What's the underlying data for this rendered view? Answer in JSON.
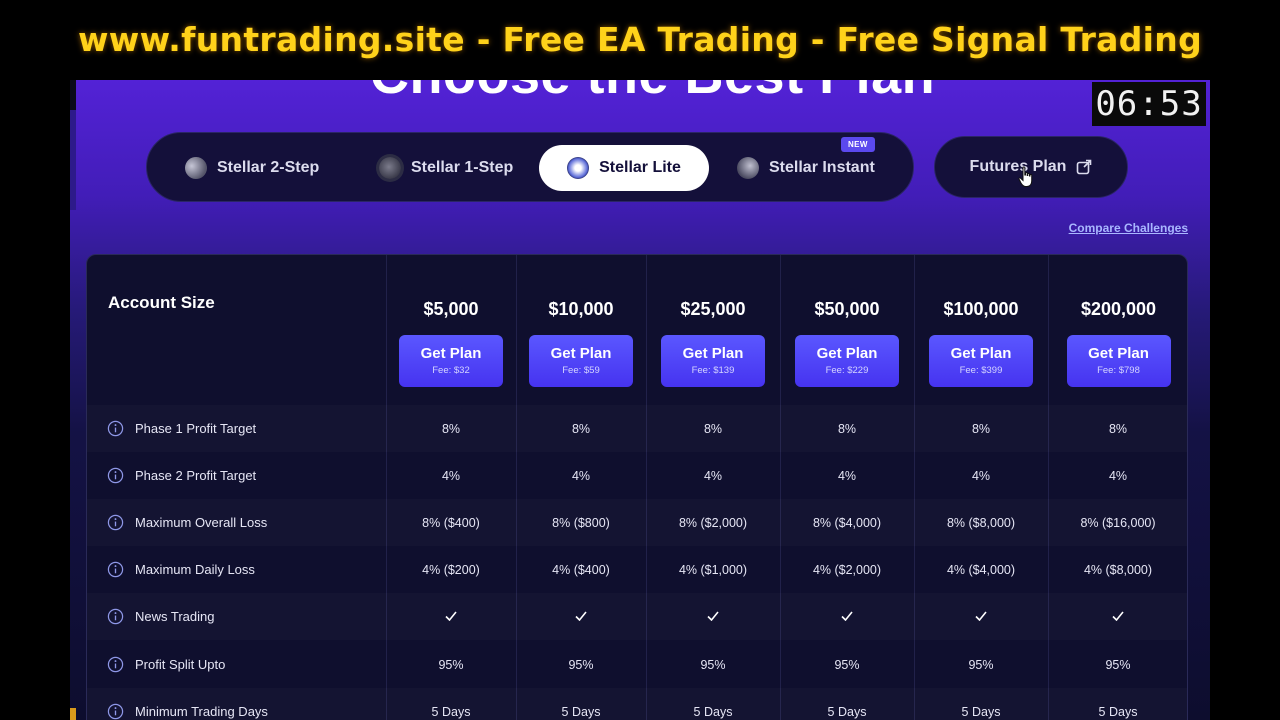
{
  "banner": {
    "text": "www.funtrading.site - Free EA Trading - Free Signal Trading"
  },
  "heading": "Choose the Best Plan",
  "timer": "06:53",
  "tabs": [
    {
      "label": "Stellar 2-Step",
      "icon": "planet-icon",
      "active": false
    },
    {
      "label": "Stellar 1-Step",
      "icon": "moon-icon",
      "active": false
    },
    {
      "label": "Stellar Lite",
      "icon": "ringed-planet-icon",
      "active": true
    },
    {
      "label": "Stellar Instant",
      "icon": "comet-icon",
      "active": false
    }
  ],
  "new_badge": "NEW",
  "futures": {
    "label": "Futures Plan",
    "icon": "external-link-icon"
  },
  "compare_link": "Compare Challenges",
  "table": {
    "size_label": "Account Size",
    "button_label": "Get Plan",
    "plans": [
      {
        "price": "$5,000",
        "fee": "Fee: $32"
      },
      {
        "price": "$10,000",
        "fee": "Fee: $59"
      },
      {
        "price": "$25,000",
        "fee": "Fee: $139"
      },
      {
        "price": "$50,000",
        "fee": "Fee: $229"
      },
      {
        "price": "$100,000",
        "fee": "Fee: $399"
      },
      {
        "price": "$200,000",
        "fee": "Fee: $798"
      }
    ],
    "rows": [
      {
        "label": "Phase 1 Profit Target",
        "values": [
          "8%",
          "8%",
          "8%",
          "8%",
          "8%",
          "8%"
        ]
      },
      {
        "label": "Phase 2 Profit Target",
        "values": [
          "4%",
          "4%",
          "4%",
          "4%",
          "4%",
          "4%"
        ]
      },
      {
        "label": "Maximum Overall Loss",
        "values": [
          "8% ($400)",
          "8% ($800)",
          "8% ($2,000)",
          "8% ($4,000)",
          "8% ($8,000)",
          "8% ($16,000)"
        ]
      },
      {
        "label": "Maximum Daily Loss",
        "values": [
          "4% ($200)",
          "4% ($400)",
          "4% ($1,000)",
          "4% ($2,000)",
          "4% ($4,000)",
          "4% ($8,000)"
        ]
      },
      {
        "label": "News Trading",
        "values": [
          "check",
          "check",
          "check",
          "check",
          "check",
          "check"
        ]
      },
      {
        "label": "Profit Split Upto",
        "values": [
          "95%",
          "95%",
          "95%",
          "95%",
          "95%",
          "95%"
        ]
      },
      {
        "label": "Minimum Trading Days",
        "values": [
          "5 Days",
          "5 Days",
          "5 Days",
          "5 Days",
          "5 Days",
          "5 Days"
        ]
      }
    ]
  },
  "colors": {
    "banner_text": "#ffd21a",
    "button": "#4f46f5",
    "link": "#a9b7ff",
    "active_tab_bg": "#ffffff"
  }
}
